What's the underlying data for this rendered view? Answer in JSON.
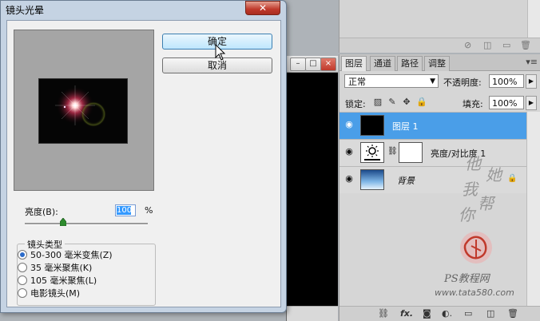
{
  "dialog": {
    "title": "镜头光晕",
    "ok_label": "确定",
    "cancel_label": "取消",
    "brightness_label": "亮度(B):",
    "brightness_value": "100",
    "brightness_unit": "%",
    "brightness_level": 100,
    "lens_group_label": "镜头类型",
    "lens_options": [
      {
        "label": "50-300 毫米变焦(Z)",
        "selected": true
      },
      {
        "label": "35 毫米聚焦(K)",
        "selected": false
      },
      {
        "label": "105 毫米聚焦(L)",
        "selected": false
      },
      {
        "label": "电影镜头(M)",
        "selected": false
      }
    ]
  },
  "layers_panel": {
    "tabs": [
      "图层",
      "通道",
      "路径",
      "调整"
    ],
    "blend_mode": "正常",
    "opacity_label": "不透明度:",
    "opacity_value": "100%",
    "lock_label": "锁定:",
    "fill_label": "填充:",
    "fill_value": "100%",
    "layers": [
      {
        "name": "图层 1",
        "selected": true
      },
      {
        "name": "亮度/对比度 1",
        "selected": false
      },
      {
        "name": "背景",
        "selected": false
      }
    ]
  },
  "watermark": {
    "text": "他她我帮你",
    "site_line1": "PS教程网",
    "site_line2": "www.tata580.com"
  },
  "colors": {
    "selection": "#4a9ee8",
    "dialog_frame": "#c5d3e3",
    "close_red": "#c0392b"
  }
}
